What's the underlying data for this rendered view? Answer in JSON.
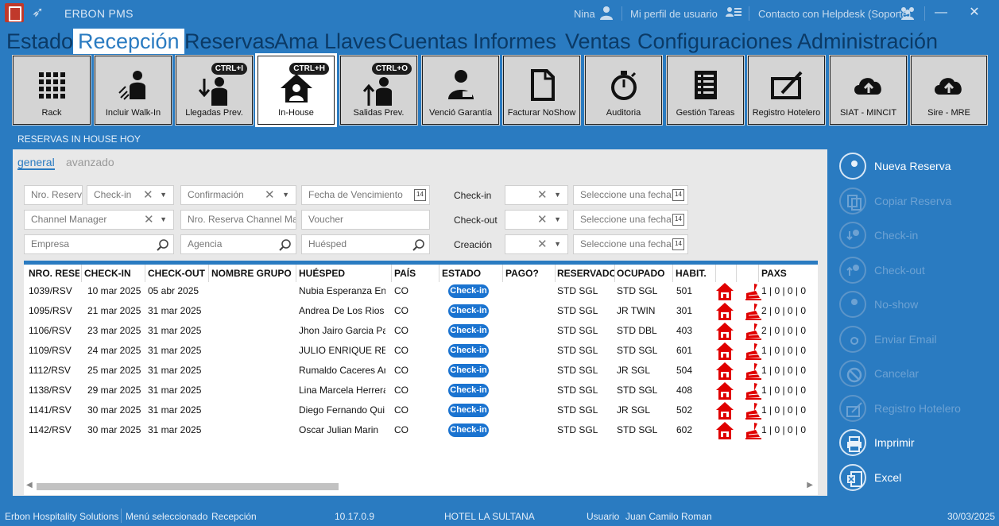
{
  "titlebar": {
    "app_title": "ERBON PMS",
    "user": "Nina",
    "profile_link": "Mi perfil de usuario",
    "helpdesk_link": "Contacto con Helpdesk (Soporte)",
    "minimize": "—",
    "close": "✕"
  },
  "menu": {
    "items": [
      "Estado",
      "Recepción",
      "Reservas",
      "Ama Llaves",
      "Cuentas",
      "Informes",
      "Ventas",
      "Configuraciones",
      "Administración"
    ],
    "active": "Recepción"
  },
  "ribbon": {
    "buttons": [
      {
        "label": "Rack",
        "icon": "grid-icon"
      },
      {
        "label": "Incluir Walk-In",
        "icon": "walk-in-icon"
      },
      {
        "label": "Llegadas Prev.",
        "icon": "arrival-icon",
        "shortcut": "CTRL+I"
      },
      {
        "label": "In-House",
        "icon": "house-person-icon",
        "shortcut": "CTRL+H"
      },
      {
        "label": "Salidas Prev.",
        "icon": "departure-icon",
        "shortcut": "CTRL+O"
      },
      {
        "label": "Venció Garantía",
        "icon": "person-card-icon"
      },
      {
        "label": "Facturar NoShow",
        "icon": "document-icon"
      },
      {
        "label": "Auditoria",
        "icon": "stopwatch-icon"
      },
      {
        "label": "Gestión Tareas",
        "icon": "checklist-icon"
      },
      {
        "label": "Registro Hotelero",
        "icon": "edit-box-icon"
      },
      {
        "label": "SIAT - MINCIT",
        "icon": "cloud-upload-icon"
      },
      {
        "label": "Sire - MRE",
        "icon": "cloud-upload-icon"
      }
    ]
  },
  "panel": {
    "title": "RESERVAS IN HOUSE HOY",
    "tabs": [
      "general",
      "avanzado"
    ],
    "filters": {
      "nro_reserva": "Nro. Reserva",
      "checkin_sel": "Check-in",
      "confirmacion": "Confirmación",
      "fecha_vencimiento": "Fecha de Vencimiento",
      "channel_manager": "Channel Manager",
      "nro_reserva_channel": "Nro. Reserva Channel Manager",
      "voucher": "Voucher",
      "empresa": "Empresa",
      "agencia": "Agencia",
      "huesped": "Huésped",
      "lbl_checkin": "Check-in",
      "lbl_checkout": "Check-out",
      "lbl_creacion": "Creación",
      "date_placeholder": "Seleccione una fecha",
      "cal_num": "14"
    }
  },
  "table": {
    "headers": [
      "NRO. RESERVA",
      "CHECK-IN",
      "CHECK-OUT",
      "NOMBRE GRUPO",
      "HUÉSPED",
      "PAÍS",
      "ESTADO",
      "PAGO?",
      "RESERVADO",
      "OCUPADO",
      "HABIT.",
      "",
      "",
      "PAXS"
    ],
    "rows": [
      {
        "nro": "1039/RSV",
        "checkin": "10 mar 2025",
        "checkout": "05 abr 2025",
        "grupo": "",
        "huesped": "Nubia Esperanza Enriquez",
        "pais": "CO",
        "estado": "Check-in",
        "pago": "",
        "reservado": "STD SGL",
        "ocupado": "STD SGL",
        "habit": "501",
        "paxs": "1 | 0 | 0 | 0"
      },
      {
        "nro": "1095/RSV",
        "checkin": "21 mar 2025",
        "checkout": "31 mar 2025",
        "grupo": "",
        "huesped": "Andrea De Los Rios",
        "pais": "CO",
        "estado": "Check-in",
        "pago": "",
        "reservado": "STD SGL",
        "ocupado": "JR TWIN",
        "habit": "301",
        "paxs": "2 | 0 | 0 | 0"
      },
      {
        "nro": "1106/RSV",
        "checkin": "23 mar 2025",
        "checkout": "31 mar 2025",
        "grupo": "",
        "huesped": "Jhon Jairo Garcia Parra",
        "pais": "CO",
        "estado": "Check-in",
        "pago": "",
        "reservado": "STD SGL",
        "ocupado": "STD DBL",
        "habit": "403",
        "paxs": "2 | 0 | 0 | 0"
      },
      {
        "nro": "1109/RSV",
        "checkin": "24 mar 2025",
        "checkout": "31 mar 2025",
        "grupo": "",
        "huesped": "JULIO ENRIQUE REYES",
        "pais": "CO",
        "estado": "Check-in",
        "pago": "",
        "reservado": "STD SGL",
        "ocupado": "STD SGL",
        "habit": "601",
        "paxs": "1 | 0 | 0 | 0"
      },
      {
        "nro": "1112/RSV",
        "checkin": "25 mar 2025",
        "checkout": "31 mar 2025",
        "grupo": "",
        "huesped": "Rumaldo Caceres Arias",
        "pais": "CO",
        "estado": "Check-in",
        "pago": "",
        "reservado": "STD SGL",
        "ocupado": "JR SGL",
        "habit": "504",
        "paxs": "1 | 0 | 0 | 0"
      },
      {
        "nro": "1138/RSV",
        "checkin": "29 mar 2025",
        "checkout": "31 mar 2025",
        "grupo": "",
        "huesped": "Lina Marcela Herrera",
        "pais": "CO",
        "estado": "Check-in",
        "pago": "",
        "reservado": "STD SGL",
        "ocupado": "STD SGL",
        "habit": "408",
        "paxs": "1 | 0 | 0 | 0"
      },
      {
        "nro": "1141/RSV",
        "checkin": "30 mar 2025",
        "checkout": "31 mar 2025",
        "grupo": "",
        "huesped": "Diego Fernando Quintero",
        "pais": "CO",
        "estado": "Check-in",
        "pago": "",
        "reservado": "STD SGL",
        "ocupado": "JR SGL",
        "habit": "502",
        "paxs": "1 | 0 | 0 | 0"
      },
      {
        "nro": "1142/RSV",
        "checkin": "30 mar 2025",
        "checkout": "31 mar 2025",
        "grupo": "",
        "huesped": "Oscar Julian Marin",
        "pais": "CO",
        "estado": "Check-in",
        "pago": "",
        "reservado": "STD SGL",
        "ocupado": "STD SGL",
        "habit": "602",
        "paxs": "1 | 0 | 0 | 0"
      }
    ]
  },
  "actions": [
    {
      "label": "Nueva Reserva",
      "icon": "person-add-icon",
      "enabled": true
    },
    {
      "label": "Copiar Reserva",
      "icon": "copy-icon",
      "enabled": false
    },
    {
      "label": "Check-in",
      "icon": "checkin-icon",
      "enabled": false
    },
    {
      "label": "Check-out",
      "icon": "checkout-icon",
      "enabled": false
    },
    {
      "label": "No-show",
      "icon": "person-icon",
      "enabled": false
    },
    {
      "label": "Enviar Email",
      "icon": "at-icon",
      "enabled": false
    },
    {
      "label": "Cancelar",
      "icon": "ban-icon",
      "enabled": false
    },
    {
      "label": "Registro Hotelero",
      "icon": "edit-box-icon",
      "enabled": false
    },
    {
      "label": "Imprimir",
      "icon": "printer-icon",
      "enabled": true
    },
    {
      "label": "Excel",
      "icon": "excel-icon",
      "enabled": true
    }
  ],
  "statusbar": {
    "company": "Erbon Hospitality Solutions",
    "menu_sel_label": "Menú seleccionado",
    "menu_sel_value": "Recepción",
    "version": "10.17.0.9",
    "hotel": "HOTEL LA SULTANA",
    "user_label": "Usuario",
    "user_value": "Juan Camilo Roman",
    "date": "30/03/2025"
  },
  "colors": {
    "brand": "#2a7bc1",
    "menu_text": "#0b3a66",
    "chip": "#1a73d0",
    "red_icon": "#e00000"
  }
}
